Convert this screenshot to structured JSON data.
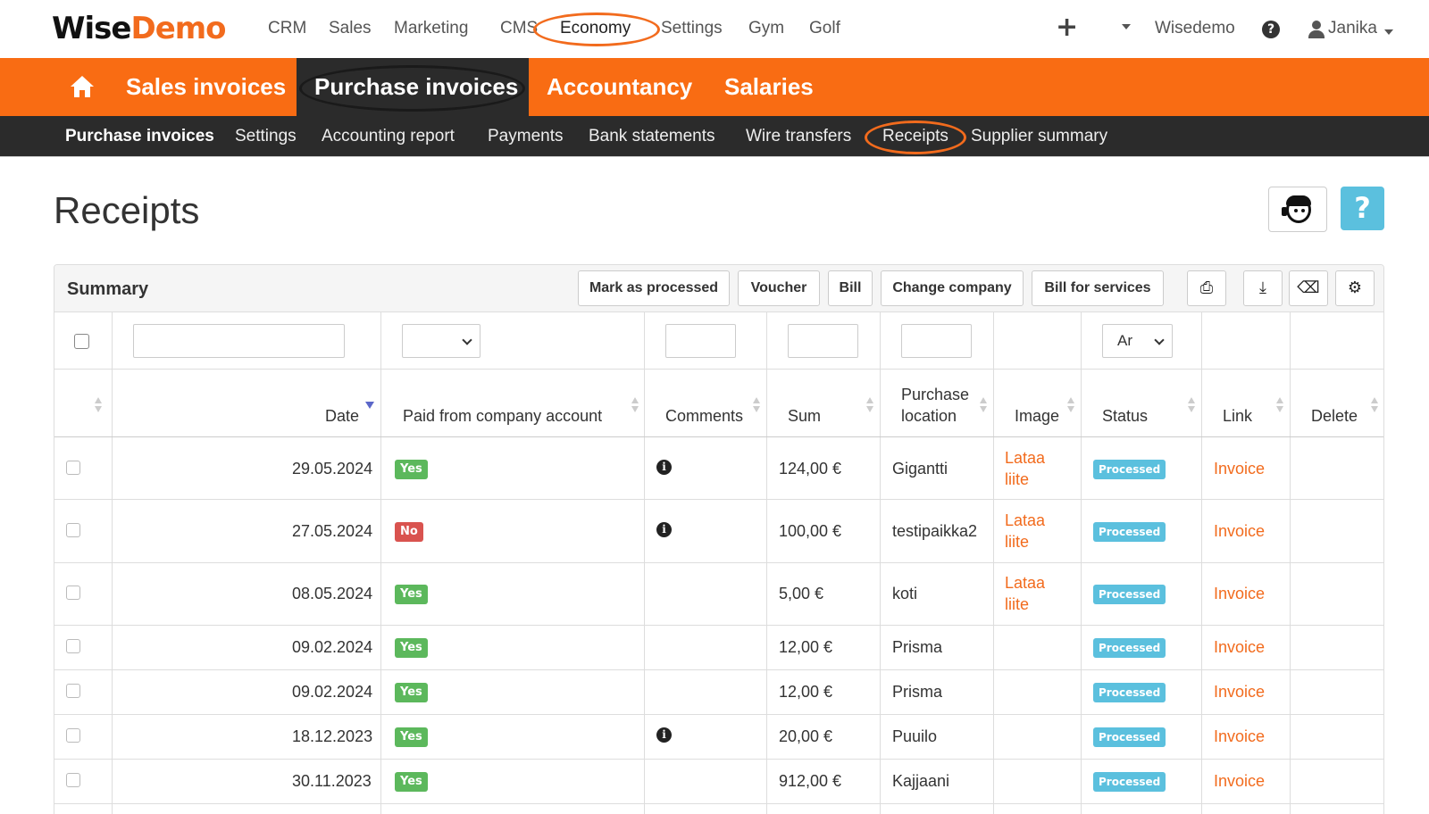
{
  "brand": {
    "logo_part1": "Wise",
    "logo_part2": "Demo",
    "accent": "#f96c13",
    "dark": "#2b2b2b"
  },
  "topnav": {
    "items": [
      "CRM",
      "Sales",
      "Marketing",
      "CMS",
      "Economy",
      "Settings",
      "Gym",
      "Golf"
    ],
    "active": "Economy",
    "plus_icon": "plus-icon",
    "company": "Wisedemo",
    "help_icon": "question-circle-icon",
    "user": "Janika"
  },
  "orangebar": {
    "home_icon": "home-icon",
    "items": [
      "Sales invoices",
      "Purchase invoices",
      "Accountancy",
      "Salaries"
    ],
    "active": "Purchase invoices"
  },
  "subbar": {
    "items": [
      "Purchase invoices",
      "Settings",
      "Accounting report",
      "Payments",
      "Bank statements",
      "Wire transfers",
      "Receipts",
      "Supplier summary"
    ],
    "bold": "Purchase invoices",
    "highlighted": "Receipts"
  },
  "page": {
    "title": "Receipts",
    "support_icon": "customer-support-icon",
    "help_label": "?"
  },
  "panel": {
    "title": "Summary",
    "buttons": [
      "Mark as processed",
      "Voucher",
      "Bill",
      "Change company",
      "Bill for services"
    ],
    "icon_buttons": [
      "print-icon",
      "download-icon",
      "eraser-icon",
      "gear-icon"
    ]
  },
  "filters": {
    "paid_select": "",
    "status_select": "Ar"
  },
  "table": {
    "headers": [
      "Date",
      "Paid from company account",
      "Comments",
      "Sum",
      "Purchase location",
      "Image",
      "Status",
      "Link",
      "Delete"
    ],
    "purchase_location_header": [
      "Purchase",
      "location"
    ],
    "rows": [
      {
        "date": "29.05.2024",
        "paid": "Yes",
        "comment": true,
        "sum": "124,00 €",
        "location": "Gigantti",
        "image": [
          "Lataa",
          "liite"
        ],
        "status": "Processed",
        "link": "Invoice"
      },
      {
        "date": "27.05.2024",
        "paid": "No",
        "comment": true,
        "sum": "100,00 €",
        "location": "testipaikka2",
        "image": [
          "Lataa",
          "liite"
        ],
        "status": "Processed",
        "link": "Invoice"
      },
      {
        "date": "08.05.2024",
        "paid": "Yes",
        "comment": false,
        "sum": "5,00 €",
        "location": "koti",
        "image": [
          "Lataa",
          "liite"
        ],
        "status": "Processed",
        "link": "Invoice"
      },
      {
        "date": "09.02.2024",
        "paid": "Yes",
        "comment": false,
        "sum": "12,00 €",
        "location": "Prisma",
        "image": null,
        "status": "Processed",
        "link": "Invoice"
      },
      {
        "date": "09.02.2024",
        "paid": "Yes",
        "comment": false,
        "sum": "12,00 €",
        "location": "Prisma",
        "image": null,
        "status": "Processed",
        "link": "Invoice"
      },
      {
        "date": "18.12.2023",
        "paid": "Yes",
        "comment": true,
        "sum": "20,00 €",
        "location": "Puuilo",
        "image": null,
        "status": "Processed",
        "link": "Invoice"
      },
      {
        "date": "30.11.2023",
        "paid": "Yes",
        "comment": false,
        "sum": "912,00 €",
        "location": "Kajjaani",
        "image": null,
        "status": "Processed",
        "link": "Invoice"
      }
    ]
  }
}
